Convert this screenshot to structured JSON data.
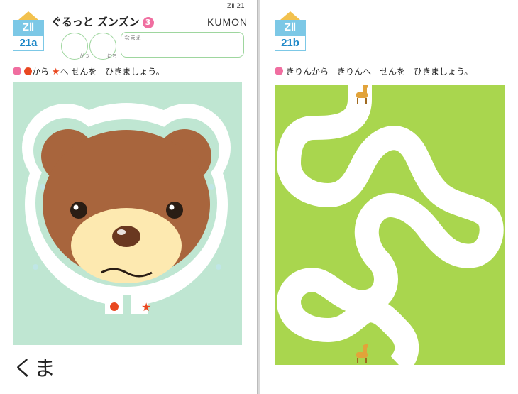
{
  "left_page": {
    "grade_top": "ZⅡ",
    "grade_bottom": "21a",
    "title": "ぐるっと ズンズン",
    "title_number": "3",
    "page_code": "ZⅡ 21",
    "logo": "KUMON",
    "date_month_label": "がつ",
    "date_day_label": "にち",
    "name_label": "なまえ",
    "instruction_from": "から",
    "instruction_to": "へ",
    "instruction_rest": "せんを　ひきましょう。",
    "word": "くま",
    "colors": {
      "background": "#bfe6d2",
      "bear_brown": "#a8653d",
      "muzzle": "#fde9b0",
      "start": "#e94820"
    }
  },
  "right_page": {
    "grade_top": "ZⅡ",
    "grade_bottom": "21b",
    "instruction": "きりんから　きりんへ　せんを　ひきましょう。",
    "colors": {
      "background": "#a9d64e",
      "path": "#ffffff"
    }
  }
}
